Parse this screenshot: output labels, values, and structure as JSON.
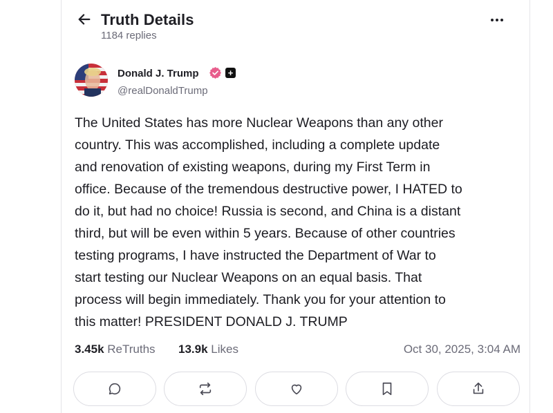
{
  "header": {
    "title": "Truth Details",
    "replies": "1184 replies"
  },
  "author": {
    "name": "Donald J. Trump",
    "handle": "@realDonaldTrump",
    "plus_badge": "+"
  },
  "post": {
    "body": "The United States has more Nuclear Weapons than any other\ncountry. This was accomplished, including a complete update\nand renovation of existing weapons, during my First Term in\noffice. Because of the tremendous destructive power, I HATED to\ndo it, but had no choice! Russia is second, and China is a distant\nthird, but will be even within 5 years. Because of other countries\ntesting programs, I have instructed the Department of War to\nstart testing our Nuclear Weapons on an equal basis. That\nprocess will begin immediately. Thank you for your attention to\nthis matter! PRESIDENT DONALD J. TRUMP"
  },
  "stats": {
    "retruths_count": "3.45k",
    "retruths_label": "ReTruths",
    "likes_count": "13.9k",
    "likes_label": "Likes",
    "timestamp": "Oct 30, 2025, 3:04 AM"
  },
  "actions": [
    {
      "icon": "reply-icon"
    },
    {
      "icon": "retruth-icon"
    },
    {
      "icon": "like-icon"
    },
    {
      "icon": "bookmark-icon"
    },
    {
      "icon": "share-icon"
    }
  ],
  "colors": {
    "verified_badge": "#e85d8c",
    "muted_text": "#6b6b78",
    "primary_text": "#1e1e24",
    "border": "#dcdce2"
  }
}
